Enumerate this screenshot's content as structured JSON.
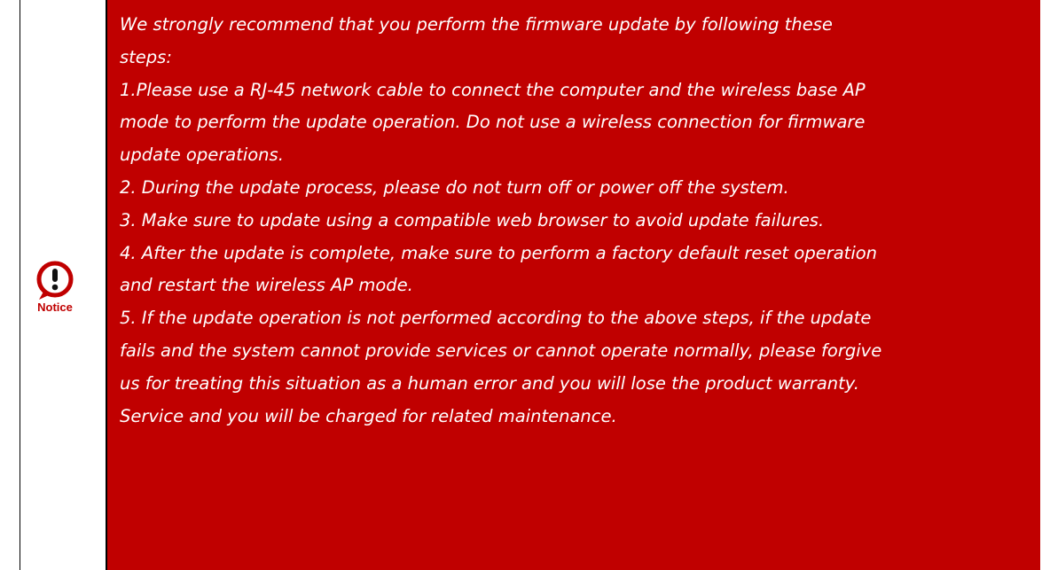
{
  "notice": {
    "icon": "exclamation-circle-icon",
    "icon_label": "Notice",
    "colors": {
      "background": "#c00000",
      "text": "#ffffff",
      "icon": "#c00000"
    },
    "lines": [
      "We strongly recommend that you perform the firmware update by following these",
      "steps:",
      "1.Please use a RJ-45 network cable to connect the computer and the wireless base AP",
      "mode to perform the update operation. Do not use a wireless connection for firmware",
      "update operations.",
      "2. During the update process, please do not turn off or power off the system.",
      "3. Make sure to update using a compatible web browser to avoid update failures.",
      "4. After the update is complete, make sure to perform a factory default reset operation",
      "and restart the wireless AP mode.",
      "5. If the update operation is not performed according to the above steps, if the update",
      "fails and the system cannot provide services or cannot operate normally, please forgive",
      "us for treating this situation as a human error and you will lose the product warranty.",
      "Service and you will be charged for related maintenance."
    ]
  }
}
